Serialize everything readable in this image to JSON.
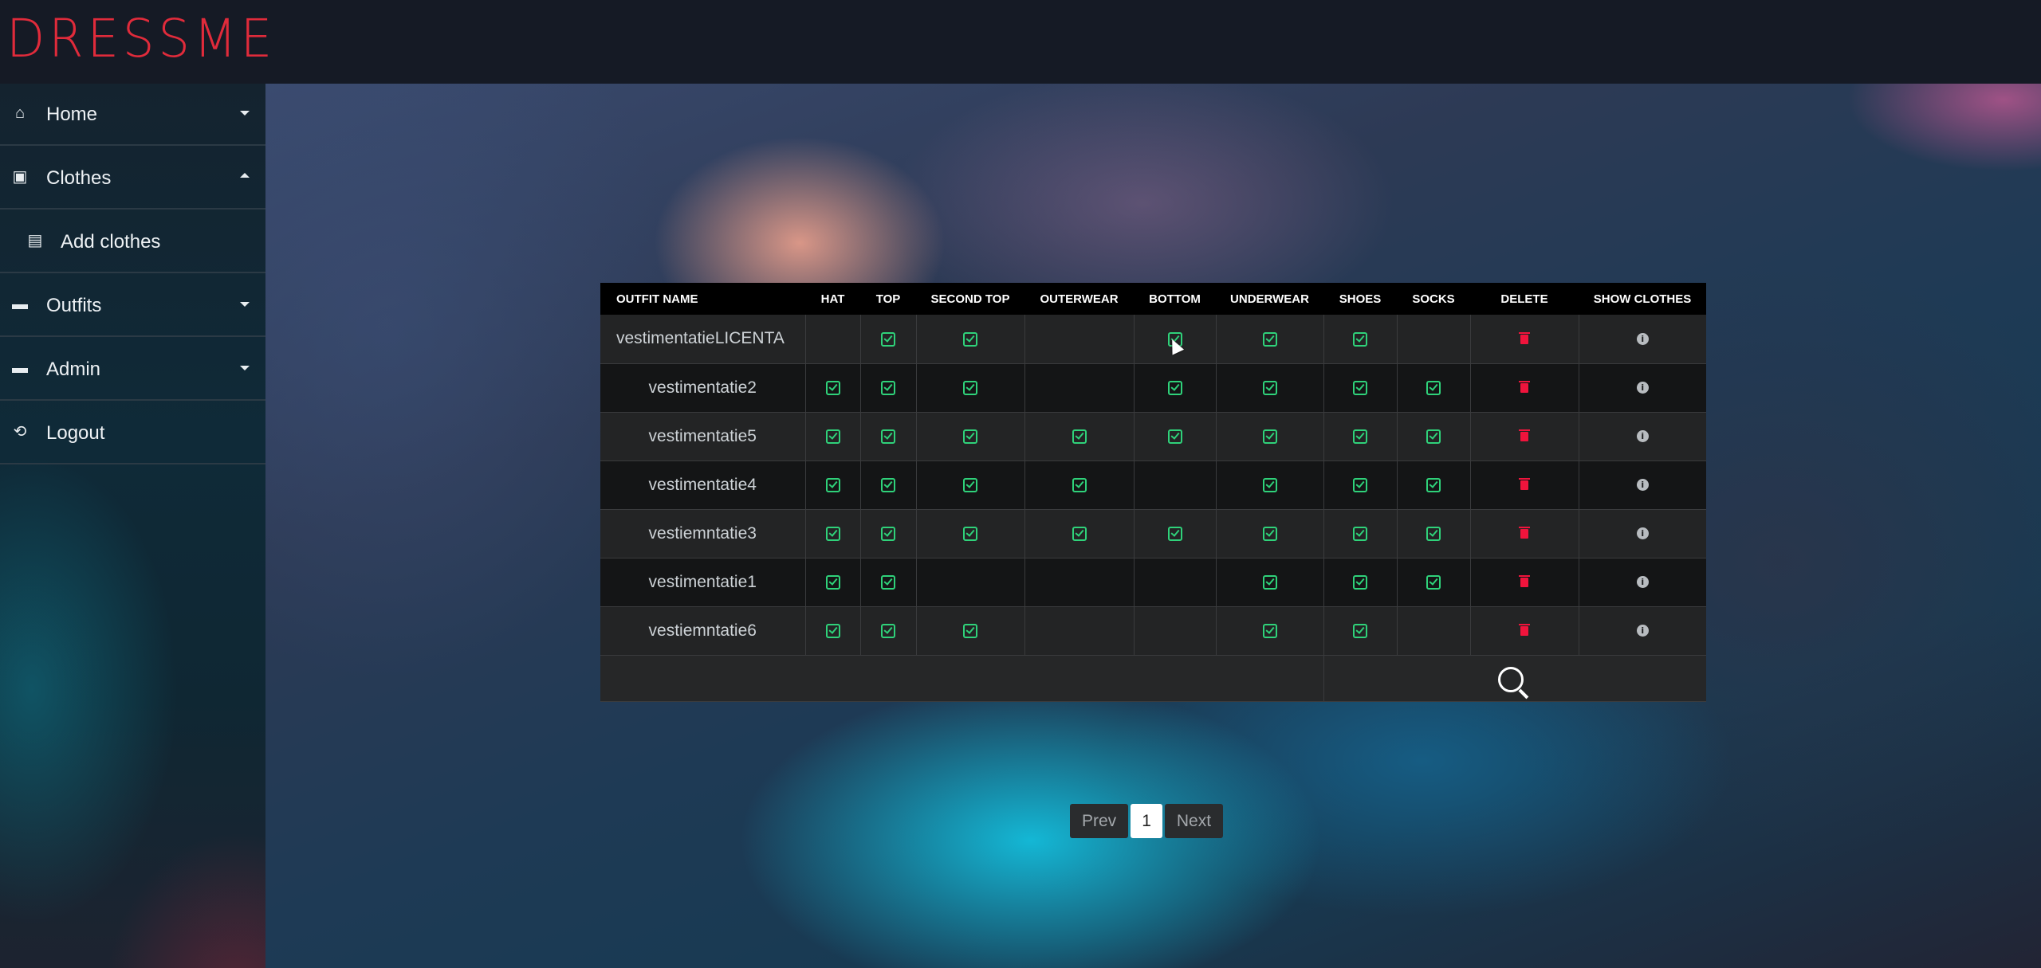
{
  "app": {
    "logo": "DRESSME"
  },
  "sidebar": {
    "items": [
      {
        "label": "Home",
        "icon": "home-icon",
        "caret": "down"
      },
      {
        "label": "Clothes",
        "icon": "clothes-icon",
        "caret": "up"
      },
      {
        "label": "Add clothes",
        "icon": "list-icon",
        "caret": ""
      },
      {
        "label": "Outfits",
        "icon": "outfits-icon",
        "caret": "down"
      },
      {
        "label": "Admin",
        "icon": "admin-icon",
        "caret": "down"
      },
      {
        "label": "Logout",
        "icon": "logout-icon",
        "caret": ""
      }
    ]
  },
  "table": {
    "headers": [
      "OUTFIT NAME",
      "HAT",
      "TOP",
      "SECOND TOP",
      "OUTERWEAR",
      "BOTTOM",
      "UNDERWEAR",
      "SHOES",
      "SOCKS",
      "DELETE",
      "SHOW CLOTHES"
    ],
    "rows": [
      {
        "name": "vestimentatieLICENTA",
        "hat": false,
        "top": true,
        "second_top": true,
        "outerwear": false,
        "bottom": true,
        "underwear": true,
        "shoes": true,
        "socks": false
      },
      {
        "name": "vestimentatie2",
        "hat": true,
        "top": true,
        "second_top": true,
        "outerwear": false,
        "bottom": true,
        "underwear": true,
        "shoes": true,
        "socks": true
      },
      {
        "name": "vestimentatie5",
        "hat": true,
        "top": true,
        "second_top": true,
        "outerwear": true,
        "bottom": true,
        "underwear": true,
        "shoes": true,
        "socks": true
      },
      {
        "name": "vestimentatie4",
        "hat": true,
        "top": true,
        "second_top": true,
        "outerwear": true,
        "bottom": false,
        "underwear": true,
        "shoes": true,
        "socks": true
      },
      {
        "name": "vestiemntatie3",
        "hat": true,
        "top": true,
        "second_top": true,
        "outerwear": true,
        "bottom": true,
        "underwear": true,
        "shoes": true,
        "socks": true
      },
      {
        "name": "vestimentatie1",
        "hat": true,
        "top": true,
        "second_top": false,
        "outerwear": false,
        "bottom": false,
        "underwear": true,
        "shoes": true,
        "socks": true
      },
      {
        "name": "vestiemntatie6",
        "hat": true,
        "top": true,
        "second_top": true,
        "outerwear": false,
        "bottom": false,
        "underwear": true,
        "shoes": true,
        "socks": false
      }
    ]
  },
  "pagination": {
    "prev": "Prev",
    "current": "1",
    "next": "Next"
  },
  "colors": {
    "logo": "#e02b3b",
    "check": "#2fd27a",
    "delete": "#f0143c"
  }
}
